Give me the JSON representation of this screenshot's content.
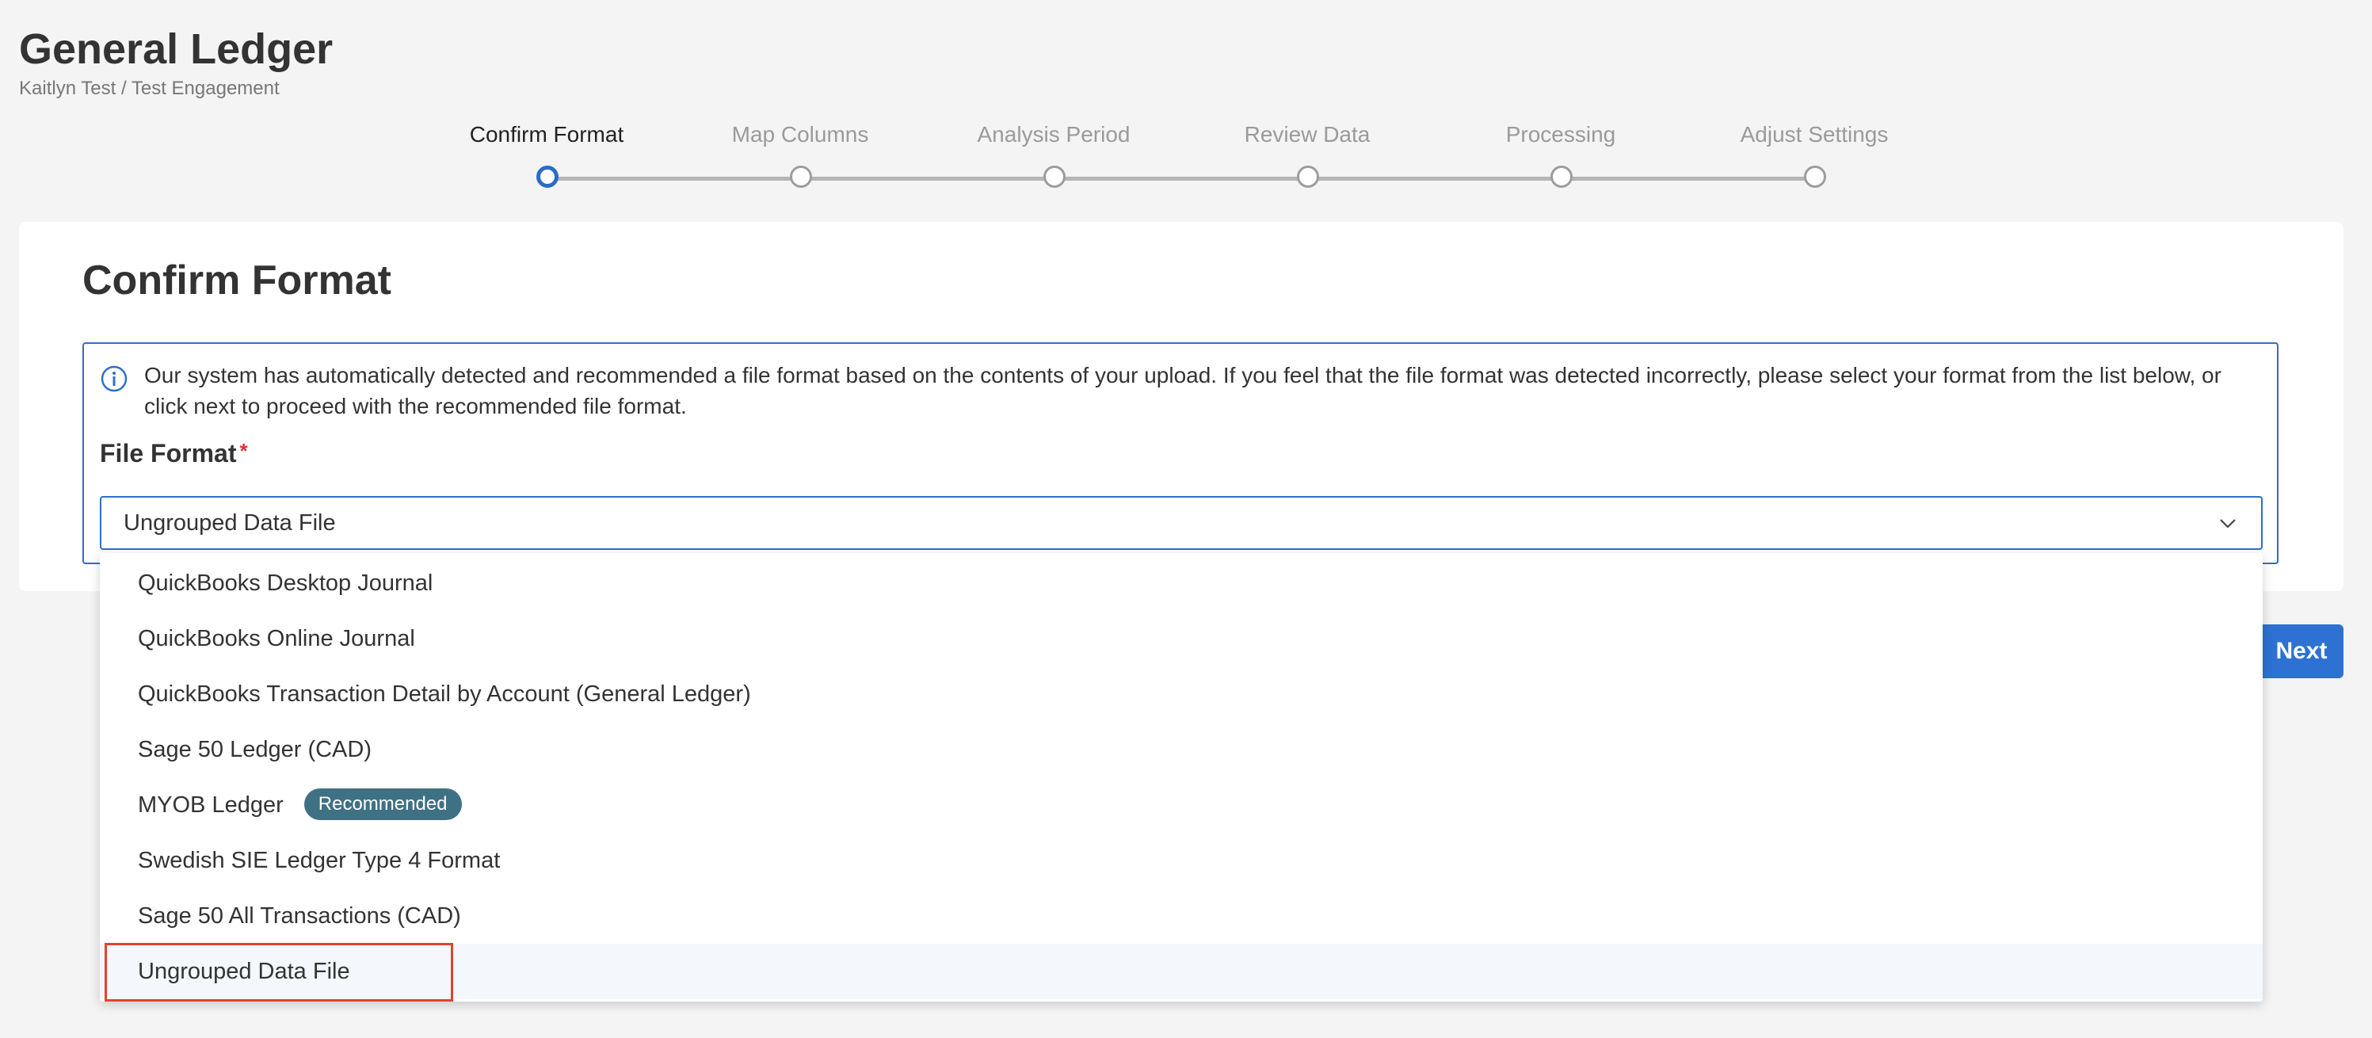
{
  "header": {
    "title": "General Ledger",
    "breadcrumb": "Kaitlyn Test / Test Engagement"
  },
  "stepper": {
    "steps": [
      {
        "label": "Confirm Format",
        "active": true
      },
      {
        "label": "Map Columns",
        "active": false
      },
      {
        "label": "Analysis Period",
        "active": false
      },
      {
        "label": "Review Data",
        "active": false
      },
      {
        "label": "Processing",
        "active": false
      },
      {
        "label": "Adjust Settings",
        "active": false
      }
    ]
  },
  "card": {
    "title": "Confirm Format",
    "info_text": "Our system has automatically detected and recommended a file format based on the contents of your upload. If you feel that the file format was detected incorrectly, please select your format from the list below, or click next to proceed with the recommended file format.",
    "field_label": "File Format",
    "required_marker": "*",
    "selected_value": "Ungrouped Data File"
  },
  "dropdown": {
    "options": [
      {
        "label": "QuickBooks Desktop Journal"
      },
      {
        "label": "QuickBooks Online Journal"
      },
      {
        "label": "QuickBooks Transaction Detail by Account (General Ledger)"
      },
      {
        "label": "Sage 50 Ledger (CAD)"
      },
      {
        "label": "MYOB Ledger",
        "badge": "Recommended"
      },
      {
        "label": "Swedish SIE Ledger Type 4 Format"
      },
      {
        "label": "Sage 50 All Transactions (CAD)"
      },
      {
        "label": "Ungrouped Data File",
        "selected": true
      }
    ]
  },
  "actions": {
    "next_label": "Next"
  },
  "colors": {
    "accent": "#2d72d2",
    "badge": "#3f7185",
    "highlight": "#e0442e",
    "step_inactive": "#9d9d9d"
  },
  "icons": {
    "info": "info-icon",
    "chevron": "chevron-down-icon"
  }
}
